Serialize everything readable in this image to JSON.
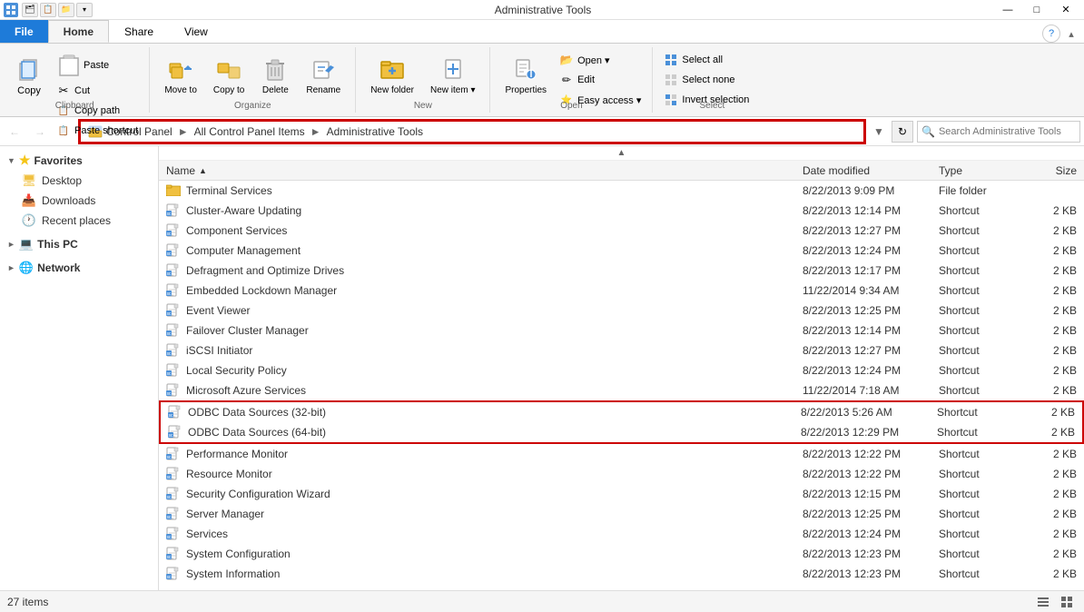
{
  "window": {
    "title": "Administrative Tools",
    "controls": [
      "—",
      "□",
      "✕"
    ]
  },
  "ribbon": {
    "tabs": [
      "File",
      "Home",
      "Share",
      "View"
    ],
    "active_tab": "Home",
    "groups": {
      "clipboard": {
        "label": "Clipboard",
        "buttons": {
          "copy": "Copy",
          "paste": "Paste",
          "cut": "Cut",
          "copy_path": "Copy path",
          "paste_shortcut": "Paste shortcut"
        }
      },
      "organize": {
        "label": "Organize",
        "buttons": {
          "move_to": "Move to",
          "copy_to": "Copy to",
          "delete": "Delete",
          "rename": "Rename"
        }
      },
      "new": {
        "label": "New",
        "buttons": {
          "new_folder": "New folder",
          "new_item": "New item ▾"
        }
      },
      "open": {
        "label": "Open",
        "buttons": {
          "open": "Open ▾",
          "edit": "Edit",
          "properties": "Properties",
          "easy_access": "Easy access ▾"
        }
      },
      "select": {
        "label": "Select",
        "buttons": {
          "select_all": "Select all",
          "select_none": "Select none",
          "invert": "Invert selection"
        }
      }
    }
  },
  "breadcrumb": {
    "items": [
      "Control Panel",
      "All Control Panel Items",
      "Administrative Tools"
    ]
  },
  "search": {
    "placeholder": "Search Administrative Tools"
  },
  "sidebar": {
    "favorites": {
      "label": "Favorites",
      "items": [
        "Desktop",
        "Downloads",
        "Recent places"
      ]
    },
    "this_pc": "This PC",
    "network": "Network"
  },
  "file_list": {
    "columns": [
      "Name",
      "Date modified",
      "Type",
      "Size"
    ],
    "files": [
      {
        "name": "Terminal Services",
        "date": "8/22/2013 9:09 PM",
        "type": "File folder",
        "size": ""
      },
      {
        "name": "Cluster-Aware Updating",
        "date": "8/22/2013 12:14 PM",
        "type": "Shortcut",
        "size": "2 KB"
      },
      {
        "name": "Component Services",
        "date": "8/22/2013 12:27 PM",
        "type": "Shortcut",
        "size": "2 KB"
      },
      {
        "name": "Computer Management",
        "date": "8/22/2013 12:24 PM",
        "type": "Shortcut",
        "size": "2 KB"
      },
      {
        "name": "Defragment and Optimize Drives",
        "date": "8/22/2013 12:17 PM",
        "type": "Shortcut",
        "size": "2 KB"
      },
      {
        "name": "Embedded Lockdown Manager",
        "date": "11/22/2014 9:34 AM",
        "type": "Shortcut",
        "size": "2 KB"
      },
      {
        "name": "Event Viewer",
        "date": "8/22/2013 12:25 PM",
        "type": "Shortcut",
        "size": "2 KB"
      },
      {
        "name": "Failover Cluster Manager",
        "date": "8/22/2013 12:14 PM",
        "type": "Shortcut",
        "size": "2 KB"
      },
      {
        "name": "iSCSI Initiator",
        "date": "8/22/2013 12:27 PM",
        "type": "Shortcut",
        "size": "2 KB"
      },
      {
        "name": "Local Security Policy",
        "date": "8/22/2013 12:24 PM",
        "type": "Shortcut",
        "size": "2 KB"
      },
      {
        "name": "Microsoft Azure Services",
        "date": "11/22/2014 7:18 AM",
        "type": "Shortcut",
        "size": "2 KB"
      },
      {
        "name": "ODBC Data Sources (32-bit)",
        "date": "8/22/2013 5:26 AM",
        "type": "Shortcut",
        "size": "2 KB",
        "highlighted": true
      },
      {
        "name": "ODBC Data Sources (64-bit)",
        "date": "8/22/2013 12:29 PM",
        "type": "Shortcut",
        "size": "2 KB",
        "highlighted": true
      },
      {
        "name": "Performance Monitor",
        "date": "8/22/2013 12:22 PM",
        "type": "Shortcut",
        "size": "2 KB"
      },
      {
        "name": "Resource Monitor",
        "date": "8/22/2013 12:22 PM",
        "type": "Shortcut",
        "size": "2 KB"
      },
      {
        "name": "Security Configuration Wizard",
        "date": "8/22/2013 12:15 PM",
        "type": "Shortcut",
        "size": "2 KB"
      },
      {
        "name": "Server Manager",
        "date": "8/22/2013 12:25 PM",
        "type": "Shortcut",
        "size": "2 KB"
      },
      {
        "name": "Services",
        "date": "8/22/2013 12:24 PM",
        "type": "Shortcut",
        "size": "2 KB"
      },
      {
        "name": "System Configuration",
        "date": "8/22/2013 12:23 PM",
        "type": "Shortcut",
        "size": "2 KB"
      },
      {
        "name": "System Information",
        "date": "8/22/2013 12:23 PM",
        "type": "Shortcut",
        "size": "2 KB"
      }
    ]
  },
  "status_bar": {
    "count_label": "27 items"
  }
}
